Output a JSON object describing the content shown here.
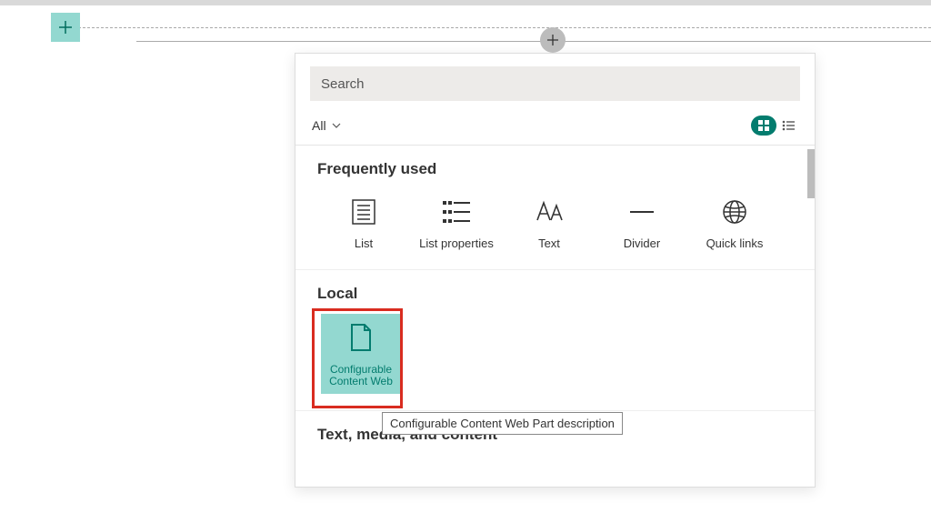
{
  "colors": {
    "teal": "#037c6e",
    "tealLight": "#93d8d0",
    "red": "#d92c20"
  },
  "search": {
    "placeholder": "Search"
  },
  "filter": {
    "label": "All"
  },
  "sections": {
    "frequently_used": {
      "title": "Frequently used",
      "items": [
        {
          "label": "List",
          "icon": "list"
        },
        {
          "label": "List properties",
          "icon": "list-properties"
        },
        {
          "label": "Text",
          "icon": "text"
        },
        {
          "label": "Divider",
          "icon": "divider"
        },
        {
          "label": "Quick links",
          "icon": "globe"
        }
      ]
    },
    "local": {
      "title": "Local",
      "item": {
        "label": "Configurable\nContent Web",
        "tooltip": "Configurable Content Web Part description"
      }
    },
    "text_media": {
      "title": "Text, media, and content"
    }
  }
}
